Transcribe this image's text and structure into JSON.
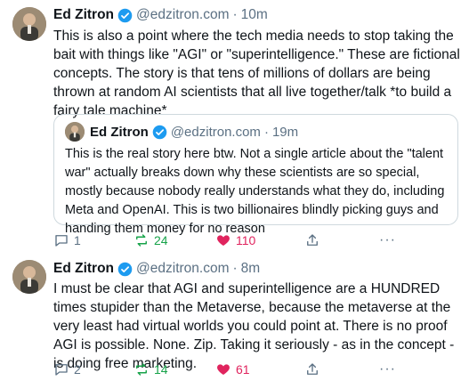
{
  "post1": {
    "author": "Ed Zitron",
    "handle": "@edzitron.com",
    "separator": "·",
    "time": "10m",
    "text": "This is also a point where the tech media needs to stop taking the bait with things like \"AGI\" or \"superintelligence.\" These are fictional concepts. The story is that tens of millions of dollars are being thrown at random AI scientists that all live together/talk *to build a fairy tale machine*",
    "quote": {
      "author": "Ed Zitron",
      "handle": "@edzitron.com",
      "separator": "·",
      "time": "19m",
      "text": "This is the real story here btw. Not a single article about the \"talent war\" actually breaks down why these scientists are so special, mostly because nobody really understands what they do, including Meta and OpenAI. This is two billionaires blindly picking guys and handing them money for no reason"
    },
    "actions": {
      "replies": "1",
      "reposts": "24",
      "likes": "110",
      "more": "···"
    }
  },
  "post2": {
    "author": "Ed Zitron",
    "handle": "@edzitron.com",
    "separator": "·",
    "time": "8m",
    "text": "I must be clear that AGI and superintelligence are a HUNDRED times stupider than the Metaverse, because the metaverse at the very least had virtual worlds you could point at. There is no proof AGI is possible. None. Zip. Taking it seriously - as in the concept - is doing free marketing.",
    "actions": {
      "replies": "2",
      "reposts": "14",
      "likes": "61",
      "more": "···"
    }
  },
  "colors": {
    "verified": "#1d9bf0",
    "repost": "#17a34a",
    "like": "#e0245e",
    "muted": "#5b7083"
  },
  "icons": [
    "verified-badge-icon",
    "reply-icon",
    "repost-icon",
    "heart-icon",
    "share-icon",
    "more-icon"
  ]
}
